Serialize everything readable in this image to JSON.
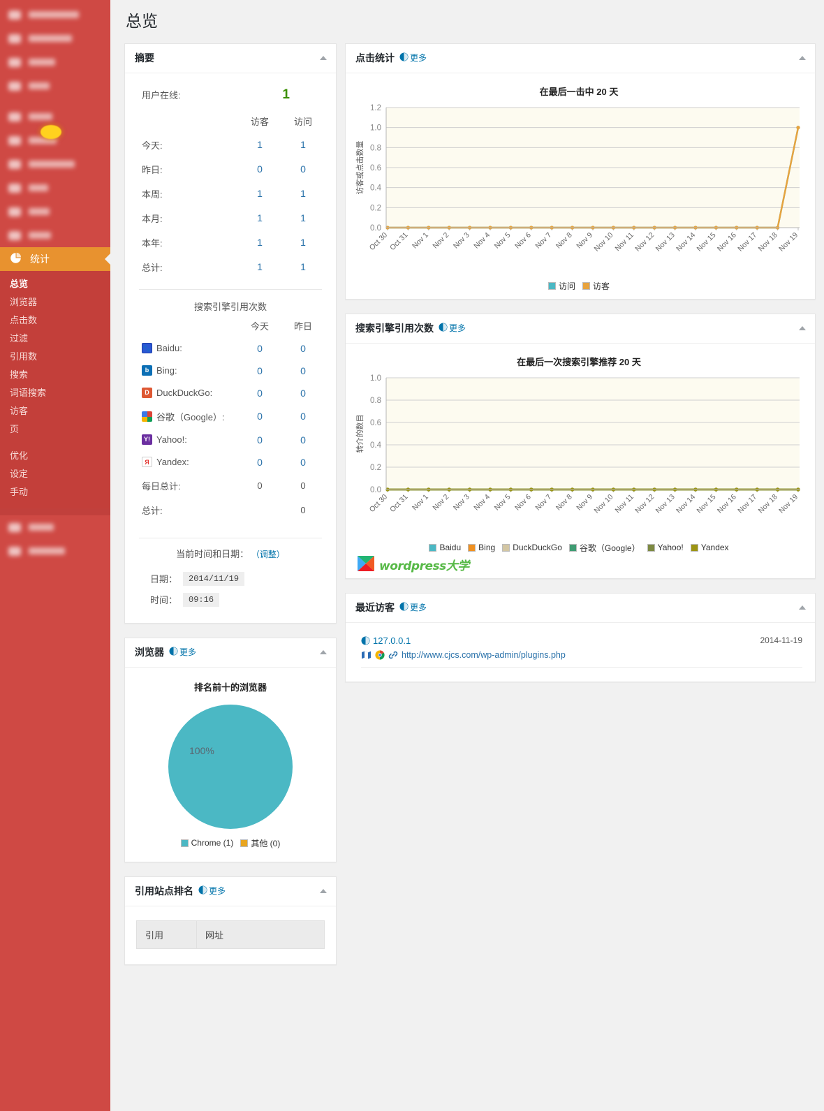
{
  "sidebar": {
    "blurred_top_items": [
      {
        "label": ""
      },
      {
        "label": ""
      },
      {
        "label": ""
      },
      {
        "label": ""
      },
      {
        "label": ""
      },
      {
        "label": ""
      },
      {
        "label": ""
      },
      {
        "label": ""
      },
      {
        "label": ""
      },
      {
        "label": ""
      }
    ],
    "active_item": {
      "label": "统计",
      "icon": "pie-chart-icon"
    },
    "submenu": [
      {
        "label": "总览",
        "current": true
      },
      {
        "label": "浏览器",
        "current": false
      },
      {
        "label": "点击数",
        "current": false
      },
      {
        "label": "过滤",
        "current": false
      },
      {
        "label": "引用数",
        "current": false
      },
      {
        "label": "搜索",
        "current": false
      },
      {
        "label": "词语搜索",
        "current": false
      },
      {
        "label": "访客",
        "current": false
      },
      {
        "label": "页",
        "current": false
      },
      {
        "label": "优化",
        "current": false
      },
      {
        "label": "设定",
        "current": false
      },
      {
        "label": "手动",
        "current": false
      }
    ],
    "colors": {
      "bg": "#cf4944",
      "submenu_bg": "#c33f3a",
      "active_bg": "#e8922f"
    }
  },
  "page": {
    "title": "总览"
  },
  "more_label": "更多",
  "summary": {
    "title": "摘要",
    "online_label": "用户在线:",
    "online_value": "1",
    "col_headers": [
      "访客",
      "访问"
    ],
    "rows": [
      {
        "label": "今天:",
        "visitors": "1",
        "visits": "1"
      },
      {
        "label": "昨日:",
        "visitors": "0",
        "visits": "0"
      },
      {
        "label": "本周:",
        "visitors": "1",
        "visits": "1"
      },
      {
        "label": "本月:",
        "visitors": "1",
        "visits": "1"
      },
      {
        "label": "本年:",
        "visitors": "1",
        "visits": "1"
      },
      {
        "label": "总计:",
        "visitors": "1",
        "visits": "1"
      }
    ],
    "engines_caption": "搜索引擎引用次数",
    "engine_col_headers": [
      "今天",
      "昨日"
    ],
    "engines": [
      {
        "name": "Baidu:",
        "icon": "baidu-icon",
        "today": "0",
        "yesterday": "0"
      },
      {
        "name": "Bing:",
        "icon": "bing-icon",
        "today": "0",
        "yesterday": "0"
      },
      {
        "name": "DuckDuckGo:",
        "icon": "duckduckgo-icon",
        "today": "0",
        "yesterday": "0"
      },
      {
        "name": "谷歌（Google）:",
        "icon": "google-icon",
        "today": "0",
        "yesterday": "0"
      },
      {
        "name": "Yahoo!:",
        "icon": "yahoo-icon",
        "today": "0",
        "yesterday": "0"
      },
      {
        "name": "Yandex:",
        "icon": "yandex-icon",
        "today": "0",
        "yesterday": "0"
      }
    ],
    "daily_total_label": "每日总计:",
    "daily_total_today": "0",
    "daily_total_yesterday": "0",
    "grand_total_label": "总计:",
    "grand_total_value": "0",
    "datetime_caption": "当前时间和日期：",
    "datetime_adjust": "（调整）",
    "date_label": "日期：",
    "date_value": "2014/11/19",
    "time_label": "时间：",
    "time_value": "09:16"
  },
  "hits_panel": {
    "title": "点击统计"
  },
  "referrers_panel": {
    "title": "搜索引擎引用次数"
  },
  "recent_panel": {
    "title": "最近访客"
  },
  "browsers_panel": {
    "title": "浏览器"
  },
  "top_referring_panel": {
    "title": "引用站点排名"
  },
  "recent_visitors": [
    {
      "ip": "127.0.0.1",
      "date": "2014-11-19",
      "url": "http://www.cjcs.com/wp-admin/plugins.php",
      "icons": [
        "map-icon",
        "chrome-icon",
        "link-icon",
        "eye-icon"
      ]
    }
  ],
  "top_referring_table": {
    "headers": [
      "引用",
      "网址"
    ],
    "rows": []
  },
  "watermark": {
    "text": "wordpress大学"
  },
  "chart_data": [
    {
      "type": "line",
      "title": "在最后一击中 20 天",
      "ylabel": "访客或点击数量",
      "xlabel": "",
      "ylim": [
        0,
        1.2
      ],
      "yticks": [
        "0.0",
        "0.2",
        "0.4",
        "0.6",
        "0.8",
        "1.0",
        "1.2"
      ],
      "grid": true,
      "legend_position": "bottom",
      "x": [
        "Oct 30",
        "Oct 31",
        "Nov 1",
        "Nov 2",
        "Nov 3",
        "Nov 4",
        "Nov 5",
        "Nov 6",
        "Nov 7",
        "Nov 8",
        "Nov 9",
        "Nov 10",
        "Nov 11",
        "Nov 12",
        "Nov 13",
        "Nov 14",
        "Nov 15",
        "Nov 16",
        "Nov 17",
        "Nov 18",
        "Nov 19"
      ],
      "series": [
        {
          "name": "访问",
          "color": "#4bb8c4",
          "values": [
            0,
            0,
            0,
            0,
            0,
            0,
            0,
            0,
            0,
            0,
            0,
            0,
            0,
            0,
            0,
            0,
            0,
            0,
            0,
            0,
            1
          ]
        },
        {
          "name": "访客",
          "color": "#e8a33d",
          "values": [
            0,
            0,
            0,
            0,
            0,
            0,
            0,
            0,
            0,
            0,
            0,
            0,
            0,
            0,
            0,
            0,
            0,
            0,
            0,
            0,
            1
          ]
        }
      ]
    },
    {
      "type": "line",
      "title": "在最后一次搜索引擎推荐 20 天",
      "ylabel": "转介的数目",
      "xlabel": "",
      "ylim": [
        0,
        1.0
      ],
      "yticks": [
        "0.0",
        "0.2",
        "0.4",
        "0.6",
        "0.8",
        "1.0"
      ],
      "grid": true,
      "legend_position": "bottom",
      "x": [
        "Oct 30",
        "Oct 31",
        "Nov 1",
        "Nov 2",
        "Nov 3",
        "Nov 4",
        "Nov 5",
        "Nov 6",
        "Nov 7",
        "Nov 8",
        "Nov 9",
        "Nov 10",
        "Nov 11",
        "Nov 12",
        "Nov 13",
        "Nov 14",
        "Nov 15",
        "Nov 16",
        "Nov 17",
        "Nov 18",
        "Nov 19"
      ],
      "series": [
        {
          "name": "Baidu",
          "color": "#4bb8c4",
          "values": [
            0,
            0,
            0,
            0,
            0,
            0,
            0,
            0,
            0,
            0,
            0,
            0,
            0,
            0,
            0,
            0,
            0,
            0,
            0,
            0,
            0
          ]
        },
        {
          "name": "Bing",
          "color": "#ef9021",
          "values": [
            0,
            0,
            0,
            0,
            0,
            0,
            0,
            0,
            0,
            0,
            0,
            0,
            0,
            0,
            0,
            0,
            0,
            0,
            0,
            0,
            0
          ]
        },
        {
          "name": "DuckDuckGo",
          "color": "#d3c6a3",
          "values": [
            0,
            0,
            0,
            0,
            0,
            0,
            0,
            0,
            0,
            0,
            0,
            0,
            0,
            0,
            0,
            0,
            0,
            0,
            0,
            0,
            0
          ]
        },
        {
          "name": "谷歌（Google）",
          "color": "#3f9c73",
          "values": [
            0,
            0,
            0,
            0,
            0,
            0,
            0,
            0,
            0,
            0,
            0,
            0,
            0,
            0,
            0,
            0,
            0,
            0,
            0,
            0,
            0
          ]
        },
        {
          "name": "Yahoo!",
          "color": "#7d8a42",
          "values": [
            0,
            0,
            0,
            0,
            0,
            0,
            0,
            0,
            0,
            0,
            0,
            0,
            0,
            0,
            0,
            0,
            0,
            0,
            0,
            0,
            0
          ]
        },
        {
          "name": "Yandex",
          "color": "#9c9413",
          "values": [
            0,
            0,
            0,
            0,
            0,
            0,
            0,
            0,
            0,
            0,
            0,
            0,
            0,
            0,
            0,
            0,
            0,
            0,
            0,
            0,
            0
          ]
        }
      ]
    },
    {
      "type": "pie",
      "title": "排名前十的浏览器",
      "labels": [
        "Chrome (1)",
        "其他 (0)"
      ],
      "values": [
        1,
        0
      ],
      "colors": [
        "#4bb8c4",
        "#e8a520"
      ],
      "data_label": "100%",
      "legend_position": "bottom"
    }
  ]
}
